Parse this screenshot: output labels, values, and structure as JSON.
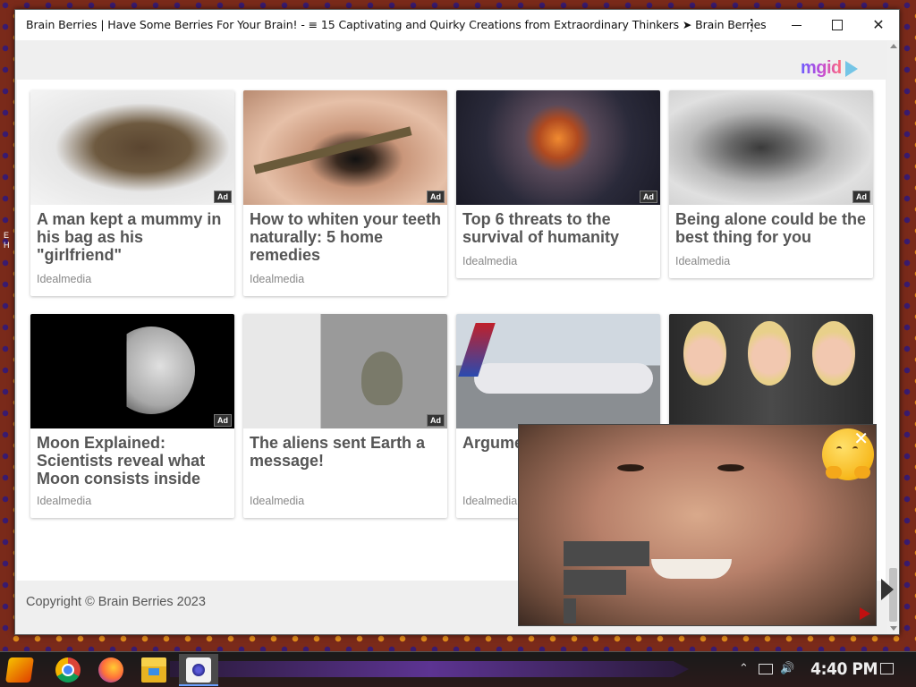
{
  "window": {
    "title": "Brain Berries | Have Some Berries For Your Brain! - ≡ 15 Captivating and Quirky Creations from Extraordinary Thinkers ➤ Brain Berries",
    "menu_glyph": "⋮",
    "close_glyph": "✕"
  },
  "ads": {
    "logo_text": "mgid",
    "badge": "Ad",
    "cards": [
      {
        "headline": "A man kept a mummy in his bag as his \"girlfriend\"",
        "source": "Idealmedia"
      },
      {
        "headline": "How to whiten your teeth naturally: 5 home remedies",
        "source": "Idealmedia"
      },
      {
        "headline": "Top 6 threats to the survival of humanity",
        "source": "Idealmedia"
      },
      {
        "headline": "Being alone could be the best thing for you",
        "source": "Idealmedia"
      },
      {
        "headline": "Moon Explained: Scientists reveal what Moon consists inside",
        "source": "Idealmedia"
      },
      {
        "headline": "The aliens sent Earth a message!",
        "source": "Idealmedia"
      },
      {
        "headline": "Argume resulte each ot",
        "source": "Idealmedia"
      }
    ]
  },
  "footer": {
    "copyright": "Copyright © Brain Berries 2023"
  },
  "video_overlay": {
    "close_glyph": "✕"
  },
  "taskbar": {
    "clock": "4:40 PM",
    "apps": [
      "start-icon",
      "chrome-icon",
      "firefox-icon",
      "file-explorer-icon",
      "brain-berries-icon"
    ]
  },
  "desktop": {
    "edge_text": "E H"
  },
  "colors": {
    "headline": "#555555",
    "source": "#888888",
    "mgid_gradient": [
      "#6a5cff",
      "#c04bd8",
      "#ff6a7a"
    ]
  }
}
